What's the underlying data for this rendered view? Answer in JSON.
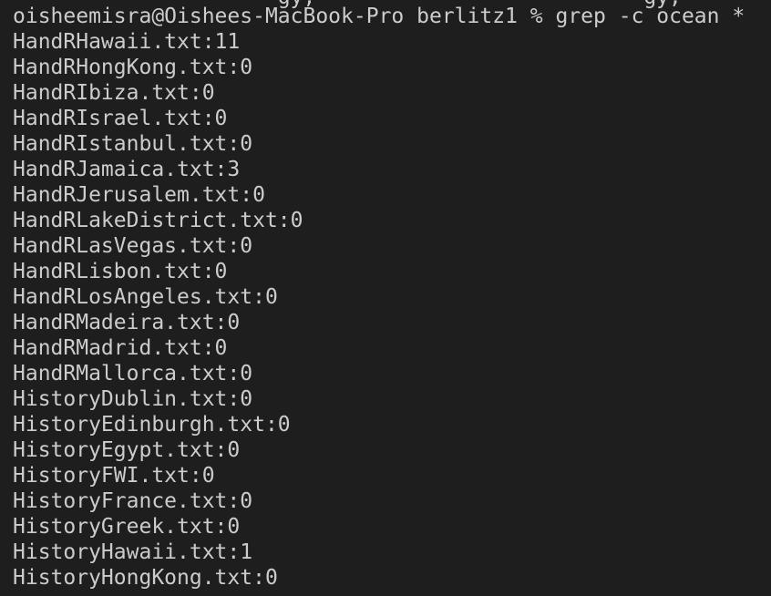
{
  "terminal": {
    "partial_previous_line": "                     gy,                          gy,                          gy,",
    "prompt": {
      "user_host": "oisheemisra@Oishees-MacBook-Pro",
      "directory": "berlitz1",
      "symbol": "%",
      "command": "grep -c ocean *"
    },
    "output": [
      "HandRHawaii.txt:11",
      "HandRHongKong.txt:0",
      "HandRIbiza.txt:0",
      "HandRIsrael.txt:0",
      "HandRIstanbul.txt:0",
      "HandRJamaica.txt:3",
      "HandRJerusalem.txt:0",
      "HandRLakeDistrict.txt:0",
      "HandRLasVegas.txt:0",
      "HandRLisbon.txt:0",
      "HandRLosAngeles.txt:0",
      "HandRMadeira.txt:0",
      "HandRMadrid.txt:0",
      "HandRMallorca.txt:0",
      "HistoryDublin.txt:0",
      "HistoryEdinburgh.txt:0",
      "HistoryEgypt.txt:0",
      "HistoryFWI.txt:0",
      "HistoryFrance.txt:0",
      "HistoryGreek.txt:0",
      "HistoryHawaii.txt:1",
      "HistoryHongKong.txt:0"
    ],
    "colors": {
      "background": "#1e1e1e",
      "foreground": "#cccccc"
    }
  }
}
